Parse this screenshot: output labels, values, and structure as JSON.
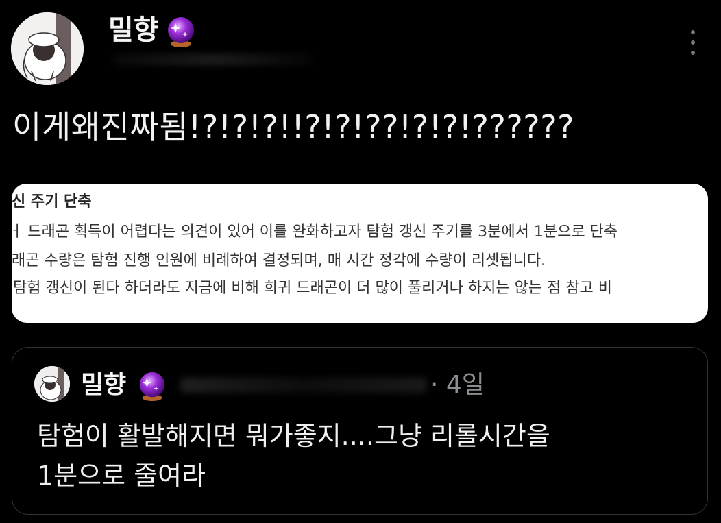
{
  "author": {
    "name": "밀향",
    "emoji": "crystal-ball-icon"
  },
  "tweet": {
    "text": "이게왜진짜됨!?!?!?!!?!?!??!?!?!??????"
  },
  "media": {
    "lines": [
      "신 주기 단축",
      "ㅓ 드래곤 획득이 어렵다는 의견이 있어 이를 완화하고자 탐험 갱신 주기를 3분에서 1분으로 단축",
      "래곤 수량은 탐험 진행 인원에 비례하여 결정되며, 매 시간 정각에 수량이 리셋됩니다.",
      "탐험 갱신이 된다 하더라도 지금에 비해 희귀 드래곤이 더 많이 풀리거나 하지는 않는 점 참고 비"
    ]
  },
  "quote": {
    "name": "밀향",
    "time": "· 4일",
    "text_line1": "탐험이 활발해지면 뭐가좋지....그냥 리롤시간을",
    "text_line2": "1분으로 줄여라"
  },
  "colors": {
    "background": "#000000",
    "text": "#e7e9ea",
    "muted": "#8a8d91",
    "border": "#333333"
  }
}
